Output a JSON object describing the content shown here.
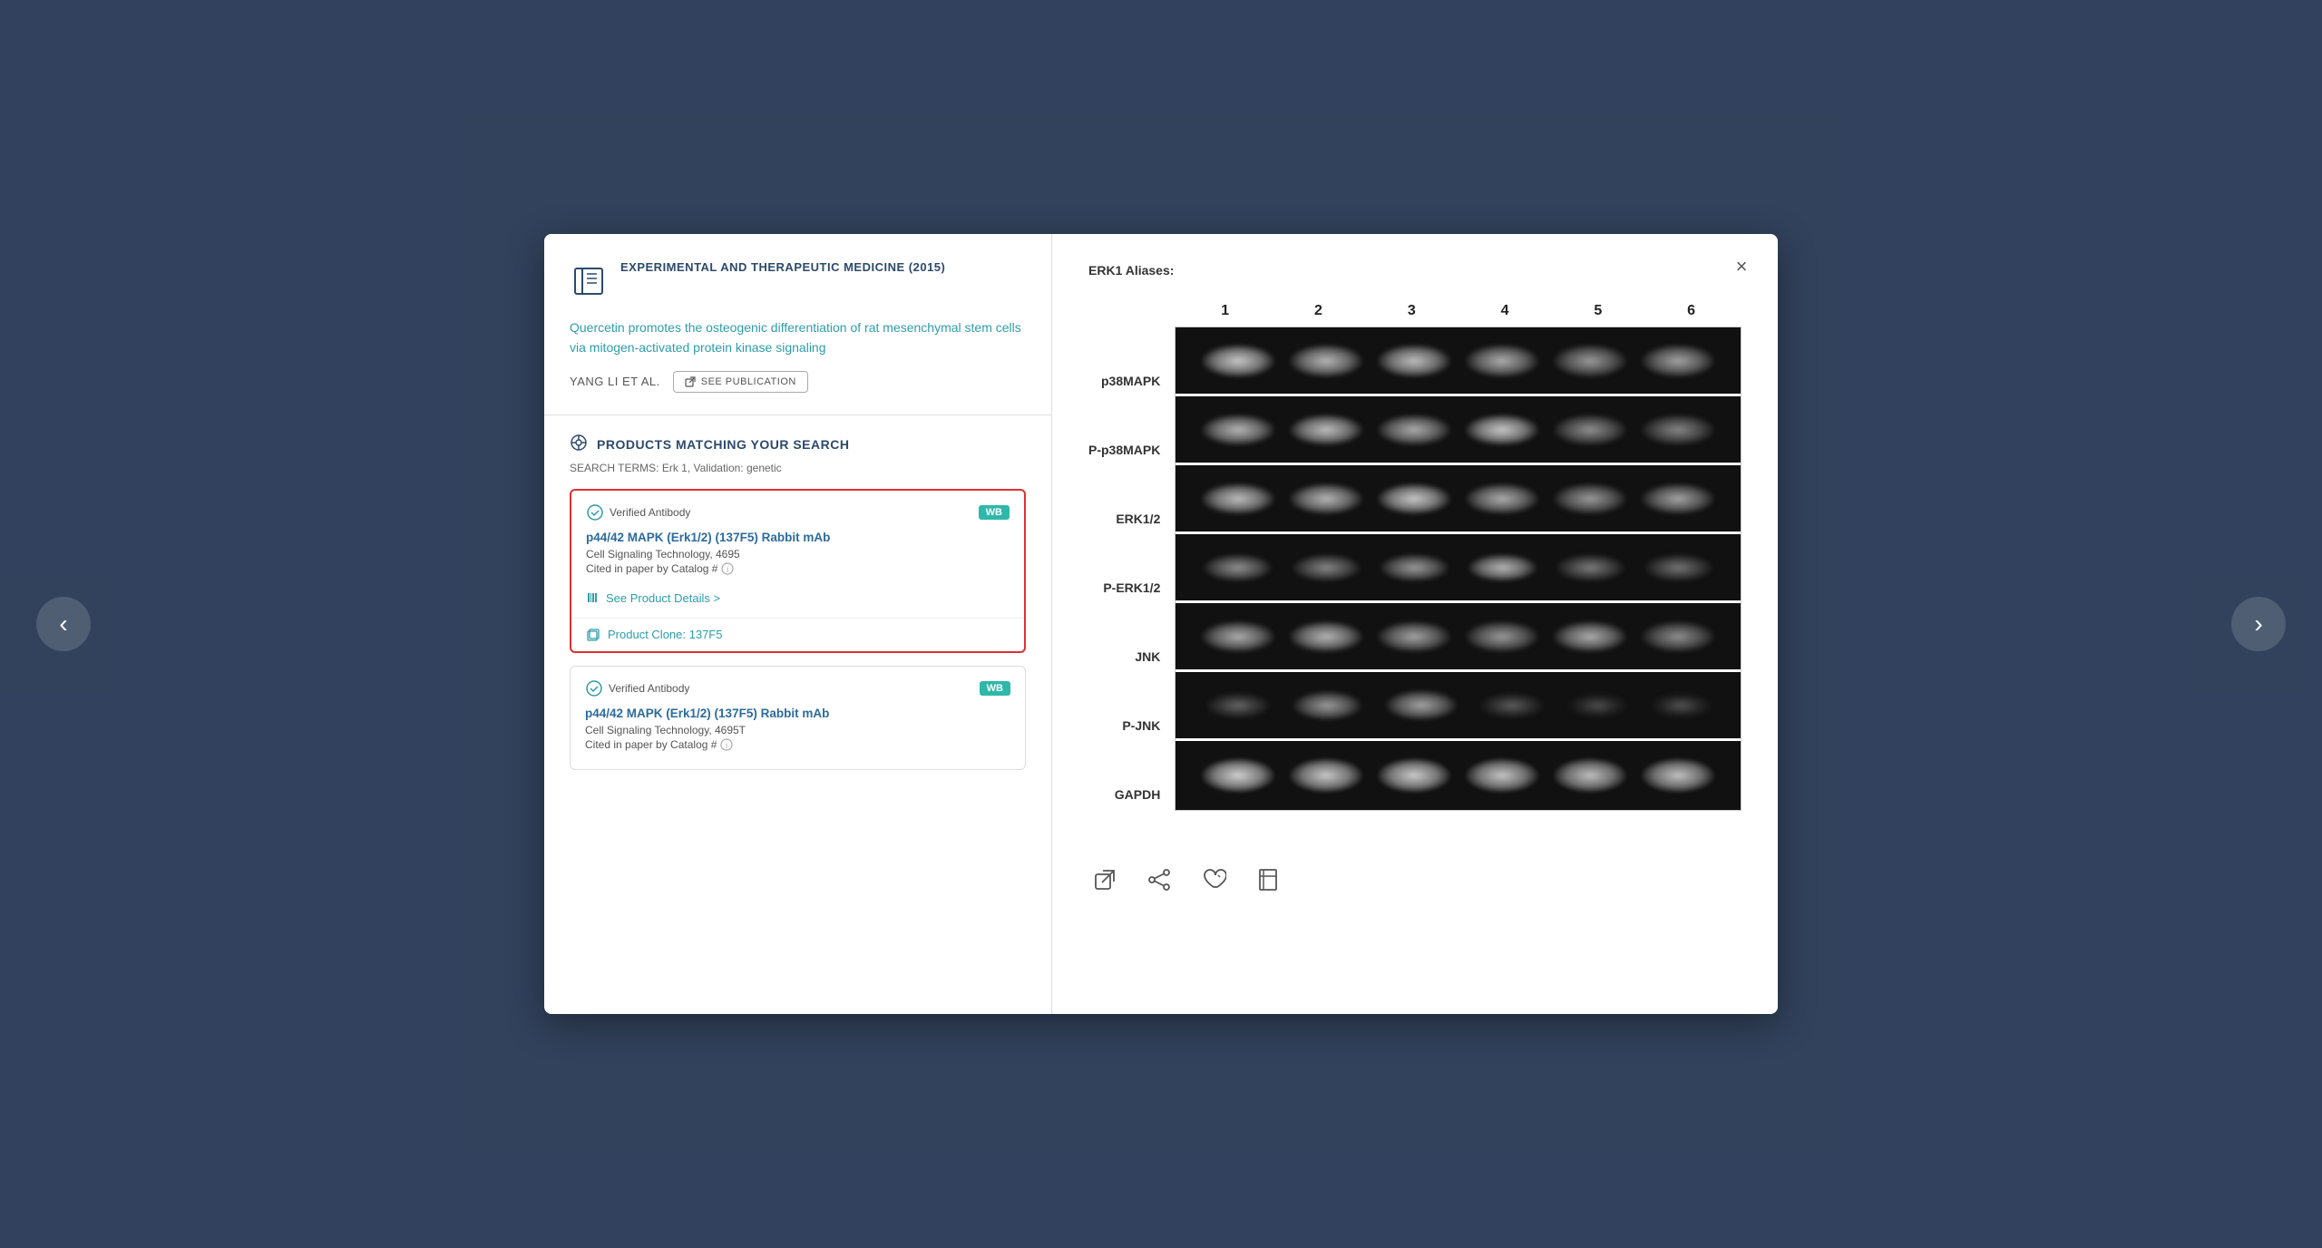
{
  "modal": {
    "close_label": "×"
  },
  "publication": {
    "journal": "EXPERIMENTAL AND THERAPEUTIC MEDICINE (2015)",
    "article_title": "Quercetin promotes the osteogenic differentiation of rat mesenchymal stem cells via mitogen-activated protein kinase signaling",
    "authors": "YANG LI Et Al.",
    "see_publication_label": "SEE PUBLICATION"
  },
  "products_section": {
    "heading": "PRODUCTS MATCHING YOUR SEARCH",
    "search_terms_label": "SEARCH TERMS:",
    "search_terms_value": "Erk 1, Validation: genetic",
    "products": [
      {
        "verified_label": "Verified Antibody",
        "wb_badge": "WB",
        "product_name": "p44/42 MAPK (Erk1/2) (137F5) Rabbit mAb",
        "vendor": "Cell Signaling Technology, 4695",
        "cited_label": "Cited in paper by Catalog #",
        "details_link": "See Product Details >",
        "clone_label": "Product Clone: 137F5",
        "highlighted": true
      },
      {
        "verified_label": "Verified Antibody",
        "wb_badge": "WB",
        "product_name": "p44/42 MAPK (Erk1/2) (137F5) Rabbit mAb",
        "vendor": "Cell Signaling Technology, 4695T",
        "cited_label": "Cited in paper by Catalog #",
        "highlighted": false
      }
    ]
  },
  "right_panel": {
    "erk1_aliases_label": "ERK1 Aliases:",
    "blot": {
      "column_headers": [
        "1",
        "2",
        "3",
        "4",
        "5",
        "6"
      ],
      "row_labels": [
        "p38MAPK",
        "P-p38MAPK",
        "ERK1/2",
        "P-ERK1/2",
        "JNK",
        "P-JNK",
        "GAPDH"
      ]
    }
  },
  "nav": {
    "left_arrow": "‹",
    "right_arrow": "›"
  },
  "icons": {
    "book_icon": "📖",
    "search_icon": "⊕",
    "verified_icon": "✓",
    "external_link": "↗",
    "product_icon": "🏷",
    "clone_icon": "⧉",
    "action_external": "⬡",
    "action_share": "⟳",
    "action_heart": "♡",
    "action_bookmark": "🔖"
  }
}
